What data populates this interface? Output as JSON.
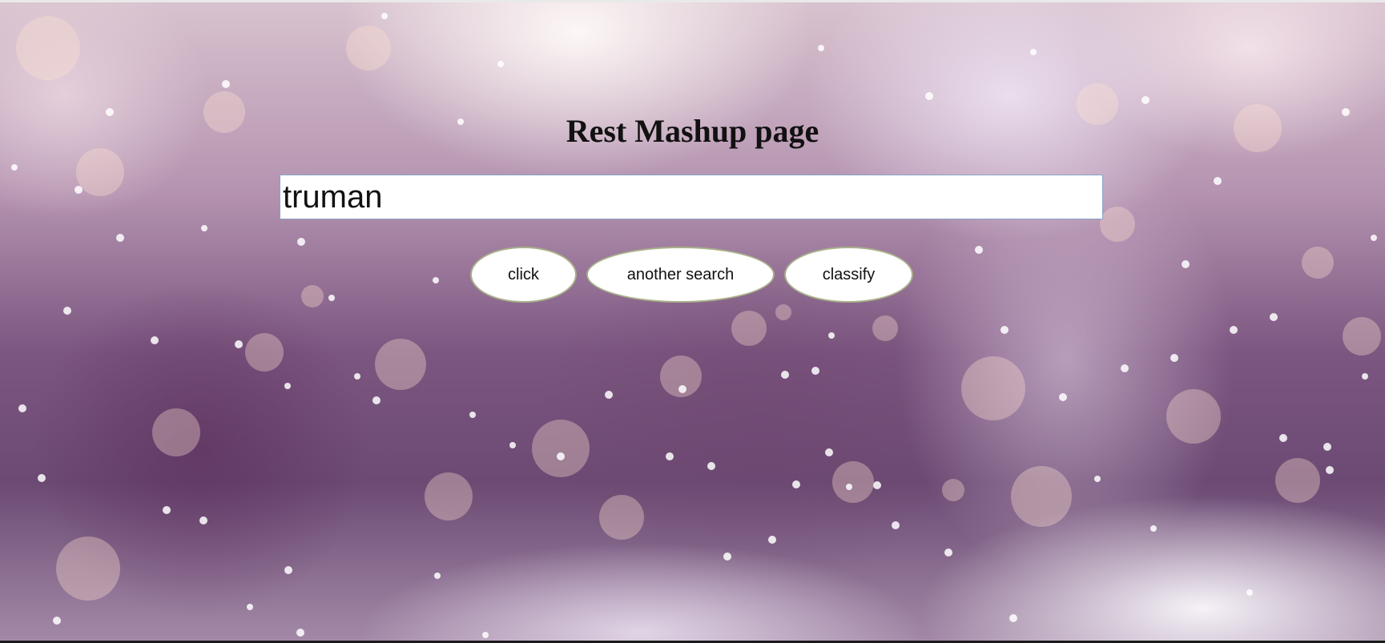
{
  "page": {
    "title": "Rest Mashup page"
  },
  "search": {
    "value": "truman"
  },
  "buttons": {
    "click_label": "click",
    "another_search_label": "another search",
    "classify_label": "classify"
  },
  "colors": {
    "button_border": "#a9b08a",
    "input_border": "#8aa3c7"
  }
}
